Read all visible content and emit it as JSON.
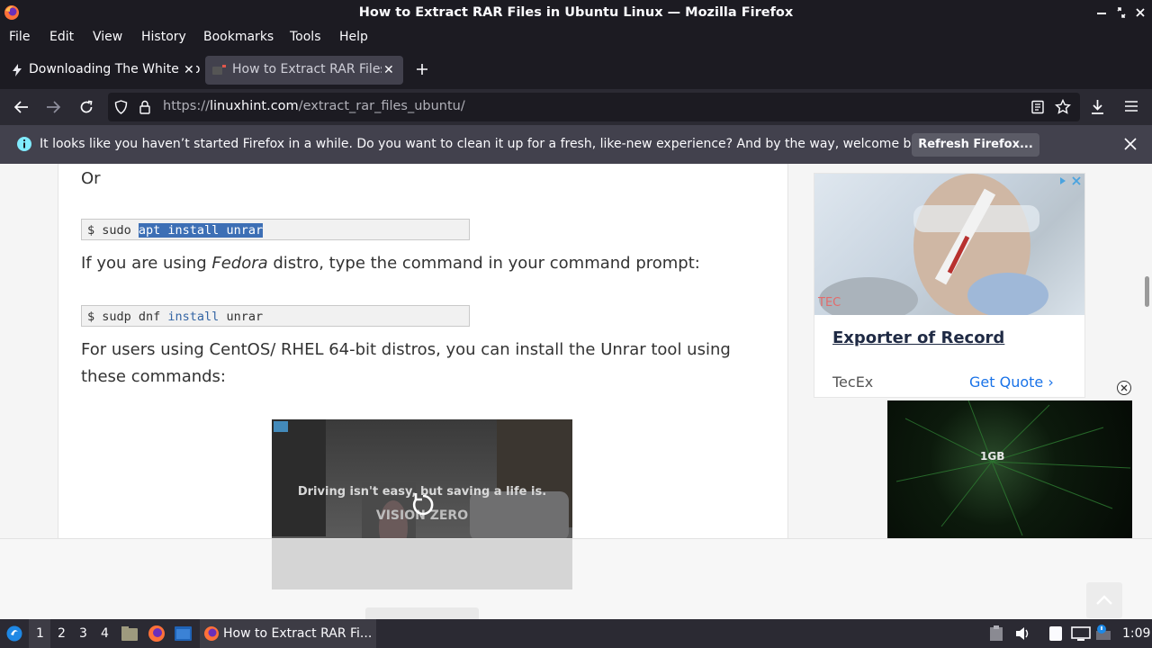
{
  "window": {
    "title": "How to Extract RAR Files in Ubuntu Linux — Mozilla Firefox"
  },
  "menu": [
    "File",
    "Edit",
    "View",
    "History",
    "Bookmarks",
    "Tools",
    "Help"
  ],
  "tabs": [
    {
      "label": "Downloading The White Ho",
      "active": false
    },
    {
      "label": "How to Extract RAR Files",
      "active": true
    }
  ],
  "url": {
    "prefix": "https://",
    "domain": "linuxhint.com",
    "path": "/extract_rar_files_ubuntu/"
  },
  "notification": {
    "message": "It looks like you haven’t started Firefox in a while. Do you want to clean it up for a fresh, like-new experience? And by the way, welcome back!",
    "button": "Refresh Firefox..."
  },
  "article": {
    "or_text": "Or",
    "cmd1": {
      "prompt": "$ sudo ",
      "selected": "apt install unrar"
    },
    "fedora": {
      "before": "If you are using ",
      "emph": "Fedora",
      "after": " distro, type the command in your command prompt:"
    },
    "cmd2": {
      "prompt": "$ sudp dnf ",
      "kw": "install",
      "rest": " unrar"
    },
    "centos_line1": "For users using CentOS/ RHEL 64-bit distros, you can install the Unrar tool using",
    "centos_line2": "these commands:"
  },
  "ads": {
    "ad1": {
      "logo": "TEC",
      "headline": "Exporter of Record",
      "brand": "TecEx",
      "cta": "Get Quote"
    },
    "video1": {
      "caption": "Driving isn't easy, but saving a life is.",
      "sub": "VISION ZERO"
    },
    "video2": {
      "text": "1GB"
    }
  },
  "taskbar": {
    "workspaces": [
      "1",
      "2",
      "3",
      "4"
    ],
    "task": "How to Extract RAR Fi...",
    "clock": "1:09"
  }
}
